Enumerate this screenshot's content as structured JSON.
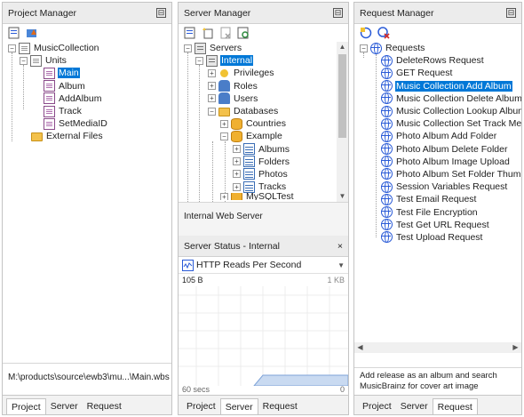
{
  "project_manager": {
    "title": "Project Manager",
    "tree": {
      "root": "MusicCollection",
      "units_label": "Units",
      "units": [
        "Main",
        "Album",
        "AddAlbum",
        "Track",
        "SetMediaID"
      ],
      "external": "External Files"
    },
    "path": "M:\\products\\source\\ewb3\\mu...\\Main.wbs",
    "tabs": [
      "Project",
      "Server",
      "Request"
    ],
    "active_tab": "Project"
  },
  "server_manager": {
    "title": "Server Manager",
    "tree": {
      "servers": "Servers",
      "internal": "Internal",
      "privileges": "Privileges",
      "roles": "Roles",
      "users": "Users",
      "databases": "Databases",
      "countries": "Countries",
      "example": "Example",
      "tables": [
        "Albums",
        "Folders",
        "Photos",
        "Tracks"
      ],
      "next_db": "MySQLTest"
    },
    "info": "Internal Web Server",
    "status_title": "Server Status - Internal",
    "status_close": "×",
    "metric": "HTTP Reads Per Second",
    "y_top": "105 B",
    "y_right": "1 KB",
    "x_left": "60 secs",
    "x_right": "0",
    "tabs": [
      "Project",
      "Server",
      "Request"
    ],
    "active_tab": "Server"
  },
  "request_manager": {
    "title": "Request Manager",
    "root": "Requests",
    "items": [
      "DeleteRows Request",
      "GET Request",
      "Music Collection Add Album",
      "Music Collection Delete Album",
      "Music Collection Lookup Albums",
      "Music Collection Set Track Media",
      "Photo Album Add Folder",
      "Photo Album Delete Folder",
      "Photo Album Image Upload",
      "Photo Album Set Folder Thumbna",
      "Session Variables Request",
      "Test Email Request",
      "Test File Encryption",
      "Test Get URL Request",
      "Test Upload Request"
    ],
    "selected_index": 2,
    "description": "Add release as an album and search MusicBrainz for cover art image",
    "tabs": [
      "Project",
      "Server",
      "Request"
    ],
    "active_tab": "Request"
  },
  "colors": {
    "selection": "#0078d7",
    "accent_blue": "#2a5bd7",
    "folder": "#f3c14b"
  },
  "icons": [
    "pin-icon",
    "document-icon",
    "folder-icon",
    "database-icon",
    "table-icon",
    "globe-icon",
    "server-icon",
    "key-icon",
    "users-icon"
  ]
}
